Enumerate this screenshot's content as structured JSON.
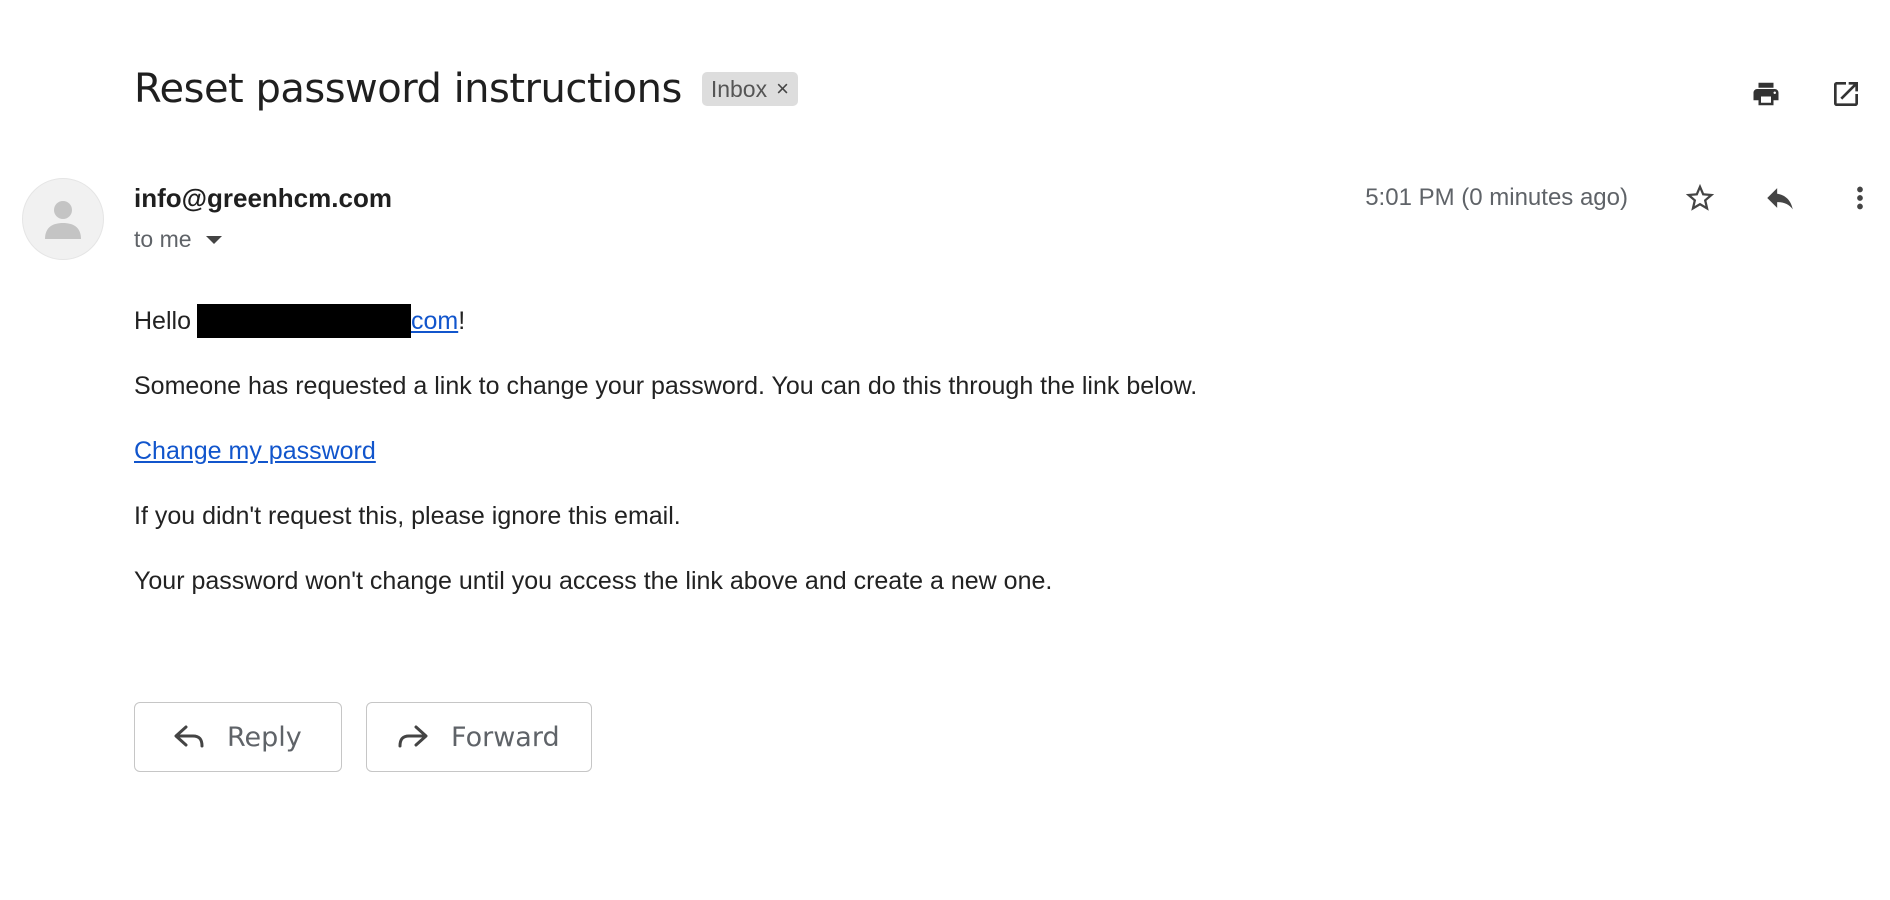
{
  "email": {
    "subject": "Reset password instructions",
    "label": {
      "name": "Inbox",
      "remove_glyph": "×"
    },
    "top_actions": [
      {
        "icon": "print-icon"
      },
      {
        "icon": "open-in-new-window-icon"
      }
    ],
    "sender": {
      "address": "info@greenhcm.com",
      "recipient_text": "to me",
      "avatar_icon": "person-icon"
    },
    "timestamp": "5:01 PM (0 minutes ago)",
    "header_actions": [
      {
        "icon": "star-icon"
      },
      {
        "icon": "reply-icon"
      },
      {
        "icon": "more-vert-icon"
      }
    ],
    "body": {
      "greeting_prefix": "Hello",
      "greeting_link_suffix": "com",
      "greeting_end": "!",
      "paragraph_1": "Someone has requested a link to change your password. You can do this through the link below.",
      "link_text": "Change my password",
      "paragraph_2": "If you didn't request this, please ignore this email.",
      "paragraph_3": "Your password won't change until you access the link above and create a new one."
    },
    "buttons": {
      "reply_label": "Reply",
      "forward_label": "Forward"
    }
  },
  "colors": {
    "link": "#1155cc",
    "chip_background": "#dddddd",
    "secondary_text": "#5f6368",
    "redaction": "#000000"
  }
}
